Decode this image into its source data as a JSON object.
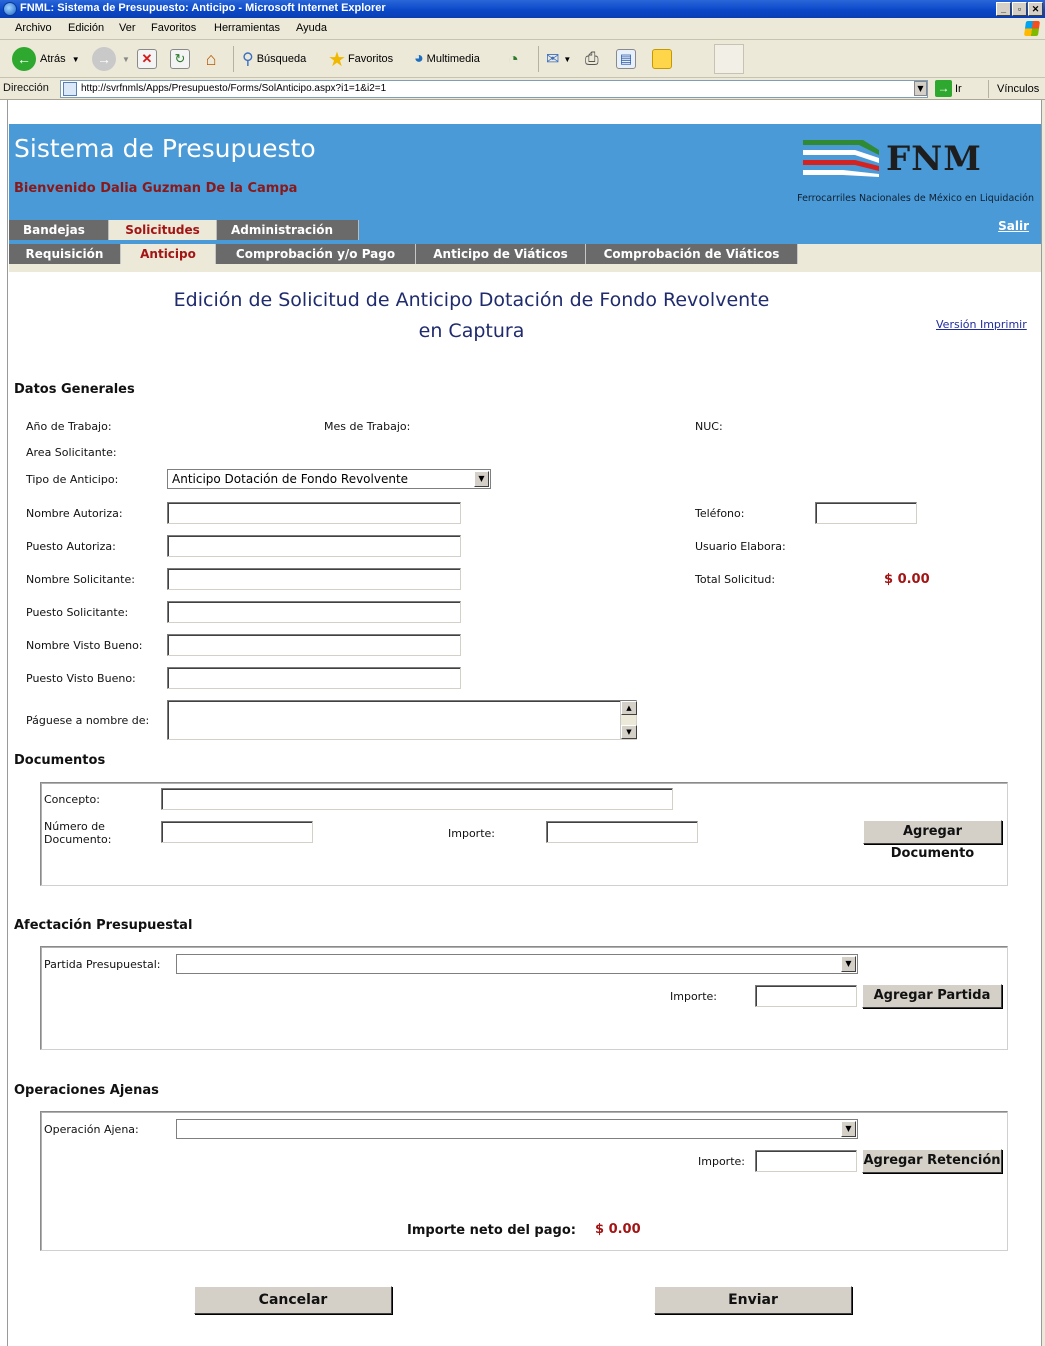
{
  "window": {
    "title": "FNML: Sistema de Presupuesto: Anticipo - Microsoft Internet Explorer"
  },
  "menu": [
    "Archivo",
    "Edición",
    "Ver",
    "Favoritos",
    "Herramientas",
    "Ayuda"
  ],
  "toolbar": {
    "back": "Atrás",
    "search": "Búsqueda",
    "favorites": "Favoritos",
    "multimedia": "Multimedia"
  },
  "address": {
    "label": "Dirección",
    "url": "http://svrfnmls/Apps/Presupuesto/Forms/SolAnticipo.aspx?i1=1&i2=1",
    "go": "Ir",
    "links": "Vínculos"
  },
  "header": {
    "system_title": "Sistema de Presupuesto",
    "welcome": "Bienvenido Dalia Guzman De la Campa",
    "logo_text": "FNM",
    "logo_subtitle": "Ferrocarriles Nacionales de México en Liquidación",
    "logout": "Salir"
  },
  "tabs_main": [
    "Bandejas",
    "Solicitudes",
    "Administración"
  ],
  "tabs_sub": [
    "Requisición",
    "Anticipo",
    "Comprobación y/o Pago",
    "Anticipo de Viáticos",
    "Comprobación de Viáticos"
  ],
  "page": {
    "title_line1": "Edición de Solicitud de Anticipo Dotación de Fondo Revolvente",
    "title_line2": "en Captura",
    "print_link": "Versión Imprimir"
  },
  "datos_generales": {
    "heading": "Datos Generales",
    "anio": "Año de Trabajo:",
    "mes": "Mes de Trabajo:",
    "nuc": "NUC:",
    "area": "Area Solicitante:",
    "tipo_label": "Tipo de Anticipo:",
    "tipo_value": "Anticipo Dotación de Fondo Revolvente",
    "nombre_autoriza": "Nombre Autoriza:",
    "puesto_autoriza": "Puesto Autoriza:",
    "nombre_solicitante": "Nombre Solicitante:",
    "puesto_solicitante": "Puesto Solicitante:",
    "nombre_vobo": "Nombre Visto Bueno:",
    "puesto_vobo": "Puesto Visto Bueno:",
    "paguese": "Páguese a nombre de:",
    "telefono": "Teléfono:",
    "usuario_elabora": "Usuario Elabora:",
    "total_label": "Total Solicitud:",
    "total_value": "$ 0.00"
  },
  "documentos": {
    "heading": "Documentos",
    "concepto": "Concepto:",
    "numero_line1": "Número de",
    "numero_line2": "Documento:",
    "importe": "Importe:",
    "add_button": "Agregar Documento"
  },
  "afectacion": {
    "heading": "Afectación Presupuestal",
    "partida": "Partida Presupuestal:",
    "importe": "Importe:",
    "add_button": "Agregar Partida"
  },
  "operaciones": {
    "heading": "Operaciones Ajenas",
    "operacion": "Operación Ajena:",
    "importe": "Importe:",
    "add_button": "Agregar Retención",
    "neto_label": "Importe neto del pago:",
    "neto_value": "$ 0.00"
  },
  "actions": {
    "cancel": "Cancelar",
    "send": "Enviar"
  }
}
